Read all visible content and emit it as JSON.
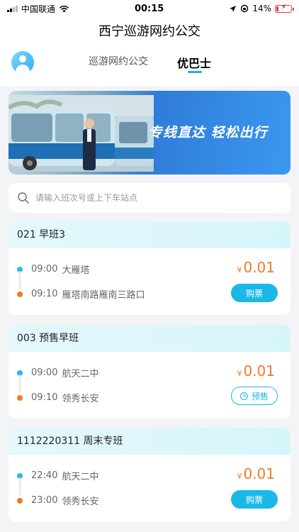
{
  "status_bar": {
    "carrier": "中国联通",
    "time": "00:15",
    "battery": "14%"
  },
  "nav": {
    "title": "西宁巡游网约公交"
  },
  "tabs": [
    {
      "label": "巡游网约公交",
      "active": false
    },
    {
      "label": "优巴士",
      "active": true
    }
  ],
  "banner": {
    "text": "专线直达 轻松出行"
  },
  "search": {
    "placeholder": "请输入班次号或上下车站点"
  },
  "routes": [
    {
      "title": "021 早班3",
      "start_time": "09:00",
      "start_stop": "大雁塔",
      "end_time": "09:10",
      "end_stop": "雁塔南路雁南三路口",
      "currency": "¥",
      "price": "0.01",
      "action": "购票"
    },
    {
      "title": "003 预售早班",
      "start_time": "09:00",
      "start_stop": "航天二中",
      "end_time": "09:10",
      "end_stop": "领秀长安",
      "currency": "¥",
      "price": "0.01",
      "action": "预售"
    },
    {
      "title": "1112220311 周末专班",
      "start_time": "22:40",
      "start_stop": "航天二中",
      "end_time": "23:00",
      "end_stop": "领秀长安",
      "currency": "¥",
      "price": "0.01",
      "action": "购票"
    }
  ],
  "colors": {
    "accent": "#1ab8e6",
    "price": "#f07b2a",
    "card_header": "#dff7fc"
  }
}
